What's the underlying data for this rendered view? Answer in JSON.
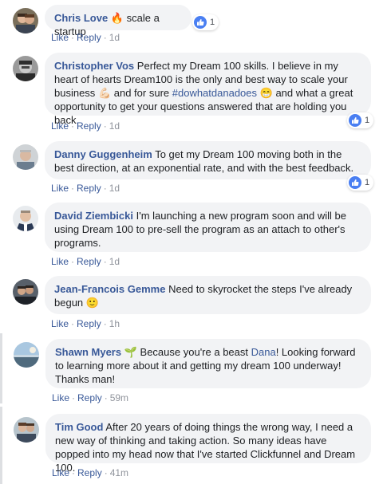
{
  "colors": {
    "accent": "#385898",
    "bubble": "#f2f3f5",
    "meta": "#90949c",
    "like_blue": "#4a7ff2"
  },
  "actions": {
    "like": "Like",
    "reply": "Reply",
    "separator": "·"
  },
  "comments": [
    {
      "name": "Chris Love",
      "name_emoji": "🔥",
      "text": "scale a startup",
      "time": "1d",
      "reactions": "1"
    },
    {
      "name": "Christopher Vos",
      "text_a": "Perfect my Dream 100 skills. I believe in my heart of hearts Dream100 is the only and best way to scale your business",
      "emoji_a": "💪🏻",
      "text_b": "and for sure",
      "hashtag": "#dowhatdanadoes",
      "emoji_b": "😁",
      "text_c": "and what a great opportunity to get your questions answered that are holding you back.",
      "time": "1d",
      "reactions": "1"
    },
    {
      "name": "Danny Guggenheim",
      "text": "To get my Dream 100 moving both in the best direction, at an exponential rate, and with the best feedback.",
      "time": "1d",
      "reactions": "1"
    },
    {
      "name": "David Ziembicki",
      "text": "I'm launching a new program soon and will be using Dream 100 to pre-sell the program as an attach to other's programs.",
      "time": "1d"
    },
    {
      "name": "Jean-Francois Gemme",
      "text": "Need to skyrocket the steps I've already begun",
      "emoji": "🙂",
      "time": "1h"
    },
    {
      "name": "Shawn Myers",
      "name_emoji": "🌱",
      "text_a": "Because you're a beast",
      "mention": "Dana",
      "text_b": "! Looking forward to learning more about it and getting my dream 100 underway! Thanks man!",
      "time": "59m"
    },
    {
      "name": "Tim Good",
      "text": "After 20 years of doing things the wrong way, I need a new way of thinking and taking action. So many ideas have popped into my head now that I've started Clickfunnel and Dream 100.",
      "time": "41m"
    }
  ]
}
